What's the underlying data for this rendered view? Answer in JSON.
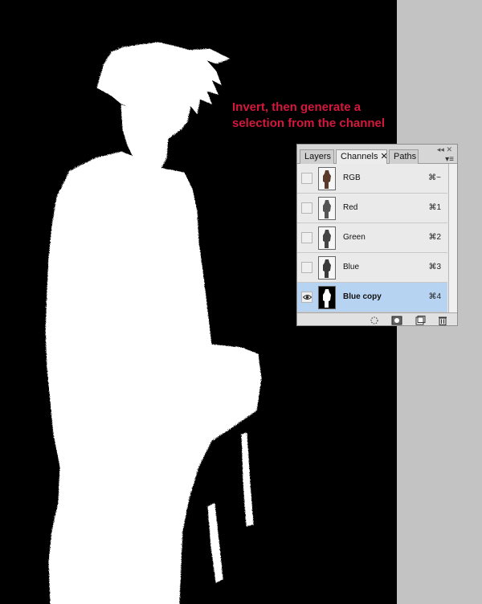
{
  "annotation": {
    "line1": "Invert, then generate a",
    "line2": "selection from the channel",
    "color": "#d4183d"
  },
  "panel": {
    "tabs": [
      {
        "label": "Layers",
        "active": false
      },
      {
        "label": "Channels",
        "active": true,
        "close": "✕"
      },
      {
        "label": "Paths",
        "active": false
      }
    ],
    "collapse_glyph": "◂◂",
    "close_glyph": "✕",
    "menu_glyph": "▾≡",
    "channels": [
      {
        "name": "RGB",
        "shortcut": "⌘~",
        "visible": false,
        "selected": false
      },
      {
        "name": "Red",
        "shortcut": "⌘1",
        "visible": false,
        "selected": false
      },
      {
        "name": "Green",
        "shortcut": "⌘2",
        "visible": false,
        "selected": false
      },
      {
        "name": "Blue",
        "shortcut": "⌘3",
        "visible": false,
        "selected": false
      },
      {
        "name": "Blue copy",
        "shortcut": "⌘4",
        "visible": true,
        "selected": true
      }
    ],
    "footer_icons": [
      "load-channel-as-selection-icon",
      "save-selection-as-channel-icon",
      "new-channel-icon",
      "trash-icon"
    ],
    "selected_color": "#b7d3f2"
  }
}
